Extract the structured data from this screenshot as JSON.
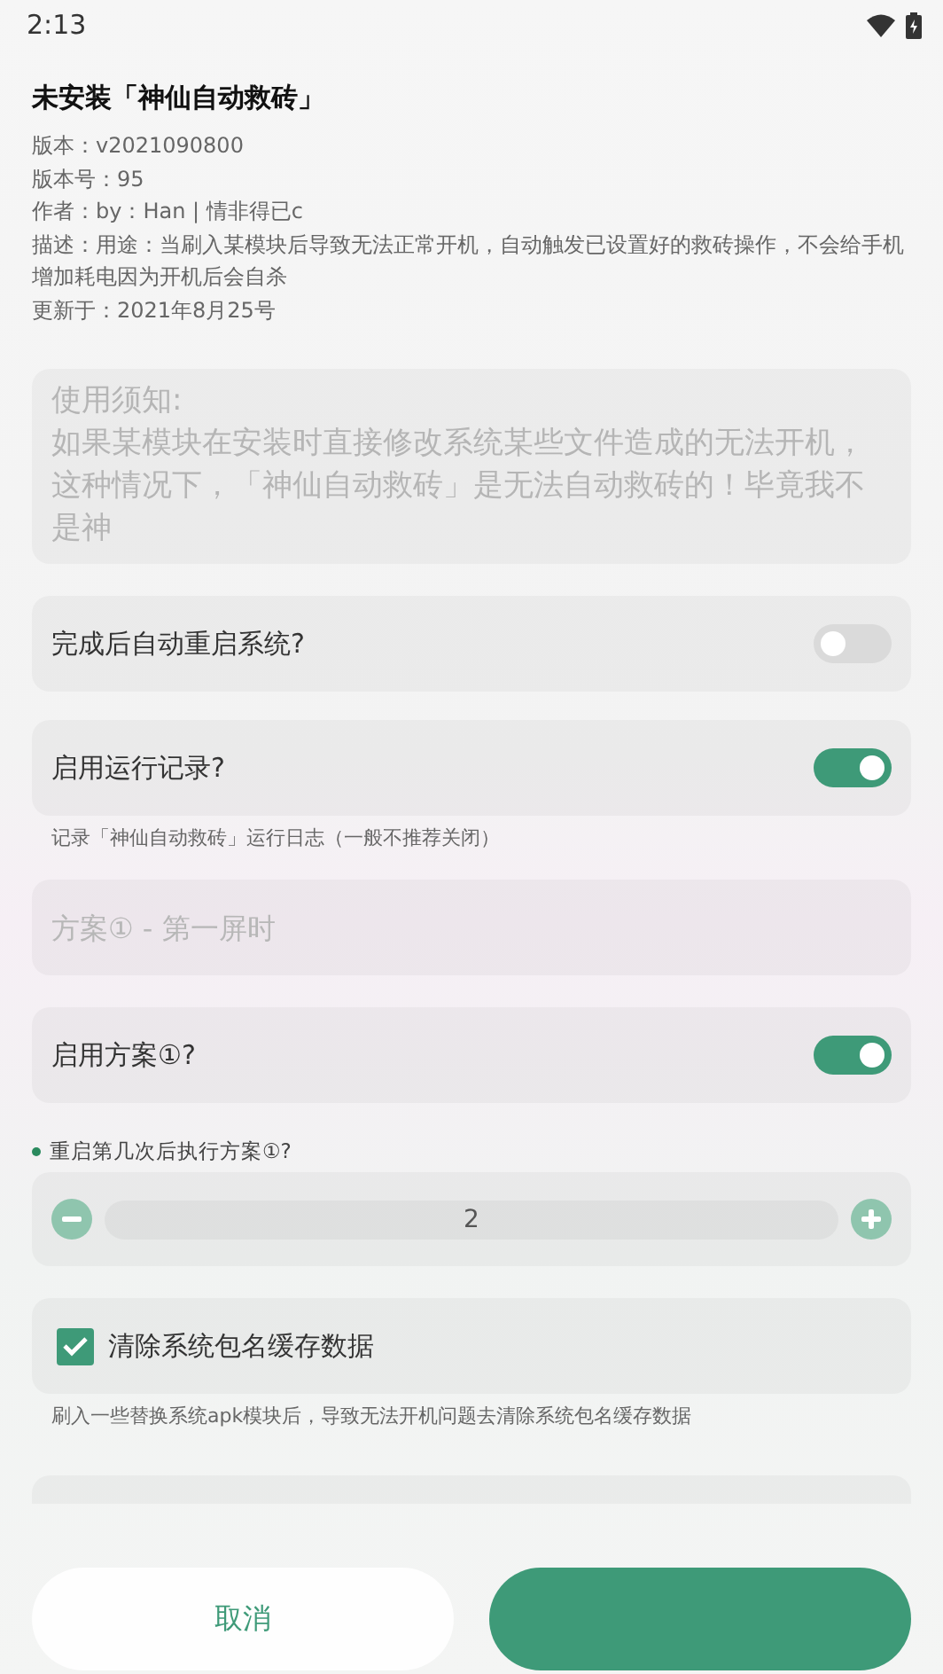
{
  "status_bar": {
    "time": "2:13"
  },
  "header": {
    "title": "未安装「神仙自动救砖」",
    "info": [
      "版本：v2021090800",
      "版本号：95",
      "作者：by：Han | 情非得已c",
      "描述：用途：当刷入某模块后导致无法正常开机，自动触发已设置好的救砖操作，不会给手机增加耗电因为开机后会自杀",
      "更新于：2021年8月25号"
    ]
  },
  "settings": [
    {
      "kind": "notice",
      "lines": [
        "使用须知:",
        "如果某模块在安装时直接修改系统某些文件造成的无法开机，这种情况下，「神仙自动救砖」是无法自动救砖的！毕竟我不是神"
      ]
    },
    {
      "kind": "toggle",
      "label": "完成后自动重启系统?",
      "on": false
    },
    {
      "kind": "toggle",
      "label": "启用运行记录?",
      "on": true,
      "note": "记录「神仙自动救砖」运行日志（一般不推荐关闭）"
    },
    {
      "kind": "field",
      "placeholder": "方案① - 第一屏时"
    },
    {
      "kind": "toggle",
      "label": "启用方案①?",
      "on": true
    },
    {
      "kind": "stepper",
      "label": "重启第几次后执行方案①?",
      "value": "2"
    },
    {
      "kind": "checkbox",
      "label": "清除系统包名缓存数据",
      "checked": true,
      "note": "刷入一些替换系统apk模块后，导致无法开机问题去清除系统包名缓存数据"
    },
    {
      "kind": "partial"
    }
  ],
  "buttons": [
    {
      "label": "取消",
      "primary": false
    },
    {
      "primary": true
    }
  ]
}
